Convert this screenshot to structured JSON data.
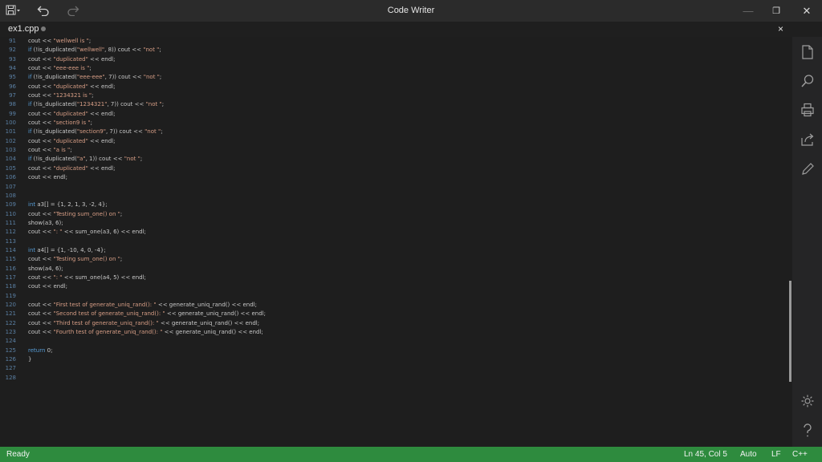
{
  "window": {
    "title": "Code Writer",
    "minimize_glyph": "—",
    "maximize_glyph": "❐",
    "close_glyph": "✕"
  },
  "tab": {
    "name": "ex1.cpp",
    "close_glyph": "×"
  },
  "editor": {
    "line_numbers": [
      "91",
      "92",
      "93",
      "94",
      "95",
      "96",
      "97",
      "98",
      "99",
      "100",
      "101",
      "102",
      "103",
      "104",
      "105",
      "106",
      "107",
      "108",
      "109",
      "110",
      "111",
      "112",
      "113",
      "114",
      "115",
      "116",
      "117",
      "118",
      "119",
      "120",
      "121",
      "122",
      "123",
      "124",
      "125",
      "126",
      "127",
      "128"
    ],
    "lines": [
      "cout << \"wellwell is \";",
      "if (!is_duplicated(\"wellwell\", 8)) cout << \"not \";",
      "cout << \"duplicated\" << endl;",
      "cout << \"eee-eee is \";",
      "if (!is_duplicated(\"eee-eee\", 7)) cout << \"not \";",
      "cout << \"duplicated\" << endl;",
      "cout << \"1234321 is \";",
      "if (!is_duplicated(\"1234321\", 7)) cout << \"not \";",
      "cout << \"duplicated\" << endl;",
      "cout << \"section9 is \";",
      "if (!is_duplicated(\"section9\", 7)) cout << \"not \";",
      "cout << \"duplicated\" << endl;",
      "cout << \"a is \";",
      "if (!is_duplicated(\"a\", 1)) cout << \"not \";",
      "cout << \"duplicated\" << endl;",
      "cout << endl;",
      "",
      "",
      "int a3[] = {1, 2, 1, 3, -2, 4};",
      "cout << \"Testing sum_one() on \";",
      "show(a3, 6);",
      "cout << \": \" << sum_one(a3, 6) << endl;",
      "",
      "int a4[] = {1, -10, 4, 0, -4};",
      "cout << \"Testing sum_one() on \";",
      "show(a4, 6);",
      "cout << \": \" << sum_one(a4, 5) << endl;",
      "cout << endl;",
      "",
      "cout << \"First test of generate_uniq_rand(): \" << generate_uniq_rand() << endl;",
      "cout << \"Second test of generate_uniq_rand(): \" << generate_uniq_rand() << endl;",
      "cout << \"Third test of generate_uniq_rand(): \" << generate_uniq_rand() << endl;",
      "cout << \"Fourth test of generate_uniq_rand(): \" << generate_uniq_rand() << endl;",
      "",
      "return 0;",
      "}",
      "",
      ""
    ]
  },
  "status": {
    "state": "Ready",
    "position": "Ln 45, Col 5",
    "encoding": "Auto",
    "line_ending": "LF",
    "language": "C++"
  },
  "colors": {
    "statusbar": "#2e8b3e",
    "keyword": "#569cd6",
    "string": "#d69d85",
    "line_number": "#5a7fa3"
  }
}
